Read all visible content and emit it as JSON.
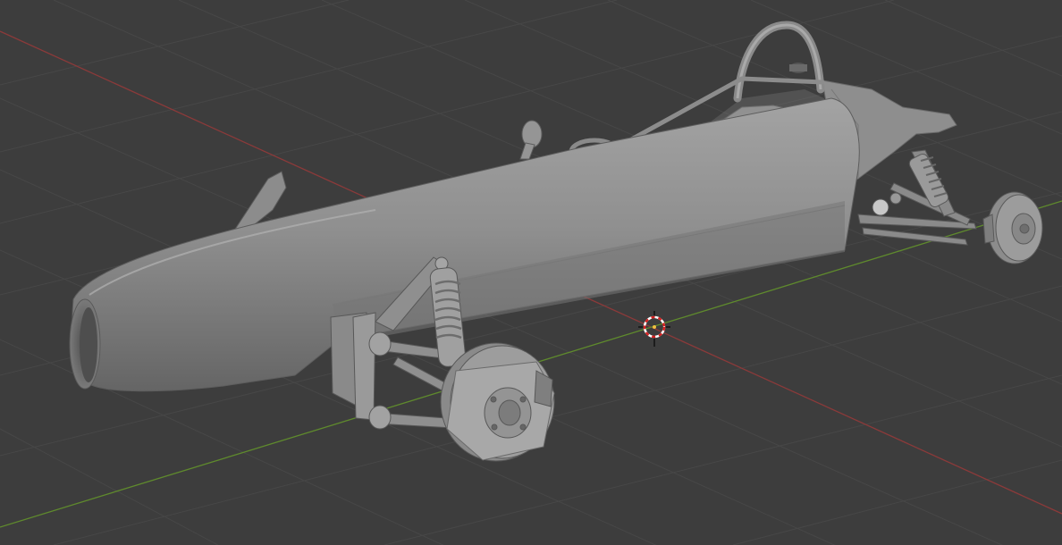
{
  "viewport": {
    "background": "#3d3d3d",
    "grid_color": "#4a4a4a",
    "x_axis_color": "#8b3a3a",
    "y_axis_color": "#5f8a2d",
    "model_color": "#8e8e8e",
    "model_shadow": "#5e5e5e",
    "model_highlight": "#a8a8a8"
  },
  "scene": {
    "object": "race-car-model",
    "cursor": "3d-cursor-icon"
  }
}
